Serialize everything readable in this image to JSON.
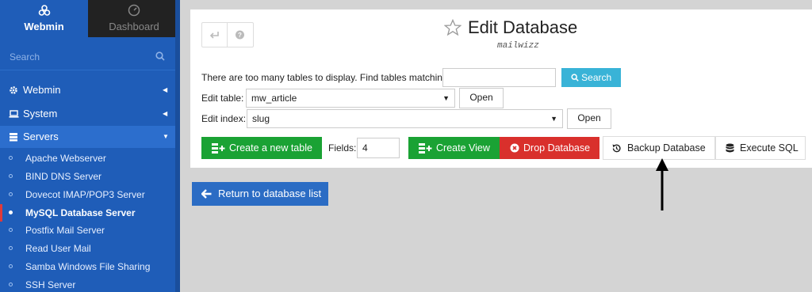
{
  "sidebar": {
    "tabs": [
      {
        "label": "Webmin",
        "icon": "webmin-logo-icon",
        "active": true
      },
      {
        "label": "Dashboard",
        "icon": "dashboard-icon",
        "active": false
      }
    ],
    "search": {
      "placeholder": "Search"
    },
    "categories": [
      {
        "label": "Webmin",
        "icon": "gear-icon",
        "expanded": false
      },
      {
        "label": "System",
        "icon": "laptop-icon",
        "expanded": false
      },
      {
        "label": "Servers",
        "icon": "server-icon",
        "expanded": true
      }
    ],
    "servers_items": [
      {
        "label": "Apache Webserver"
      },
      {
        "label": "BIND DNS Server"
      },
      {
        "label": "Dovecot IMAP/POP3 Server"
      },
      {
        "label": "MySQL Database Server",
        "active": true
      },
      {
        "label": "Postfix Mail Server"
      },
      {
        "label": "Read User Mail"
      },
      {
        "label": "Samba Windows File Sharing"
      },
      {
        "label": "SSH Server"
      }
    ]
  },
  "header": {
    "title": "Edit Database",
    "subtitle": "mailwizz"
  },
  "find": {
    "label": "There are too many tables to display. Find tables matching:",
    "value": "",
    "button": "Search"
  },
  "edit_table": {
    "label": "Edit table:",
    "selected": "mw_article",
    "button": "Open"
  },
  "edit_index": {
    "label": "Edit index:",
    "selected": "slug",
    "button": "Open"
  },
  "actions": {
    "create_table": "Create a new table",
    "fields_label": "Fields:",
    "fields_value": "4",
    "create_view": "Create View",
    "drop_database": "Drop Database",
    "backup_database": "Backup Database",
    "execute_sql": "Execute SQL"
  },
  "return_button": "Return to database list",
  "colors": {
    "sidebar": "#1f5db8",
    "green": "#1aa234",
    "red": "#d9302c",
    "info": "#39b3d7",
    "primary": "#2b6cc4"
  }
}
